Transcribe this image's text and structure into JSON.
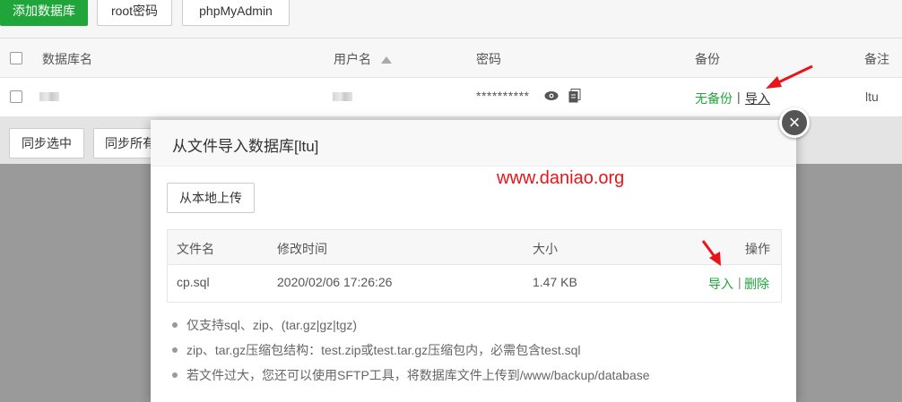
{
  "toolbar": {
    "add_db": "添加数据库",
    "root_pw": "root密码",
    "phpmyadmin": "phpMyAdmin"
  },
  "table": {
    "headers": {
      "name": "数据库名",
      "user": "用户名",
      "password": "密码",
      "backup": "备份",
      "note": "备注"
    },
    "row": {
      "password_mask": "**********",
      "backup_status": "无备份",
      "separator": "|",
      "import_link": "导入",
      "note": "ltu"
    }
  },
  "bottom_buttons": {
    "sync_selected": "同步选中",
    "sync_all": "同步所有"
  },
  "modal": {
    "title": "从文件导入数据库[ltu]",
    "upload_label": "从本地上传",
    "close_glyph": "×",
    "file_table": {
      "headers": {
        "filename": "文件名",
        "modified": "修改时间",
        "size": "大小",
        "actions": "操作"
      },
      "rows": [
        {
          "filename": "cp.sql",
          "modified": "2020/02/06 17:26:26",
          "size": "1.47 KB",
          "import": "导入",
          "separator": "|",
          "delete": "删除"
        }
      ]
    },
    "notes": [
      "仅支持sql、zip、(tar.gz|gz|tgz)",
      "zip、tar.gz压缩包结构：test.zip或test.tar.gz压缩包内，必需包含test.sql",
      "若文件过大，您还可以使用SFTP工具，将数据库文件上传到/www/backup/database"
    ]
  },
  "watermark": "www.daniao.org",
  "colors": {
    "accent_green": "#20a53a",
    "annotation_red": "#e8141c"
  }
}
